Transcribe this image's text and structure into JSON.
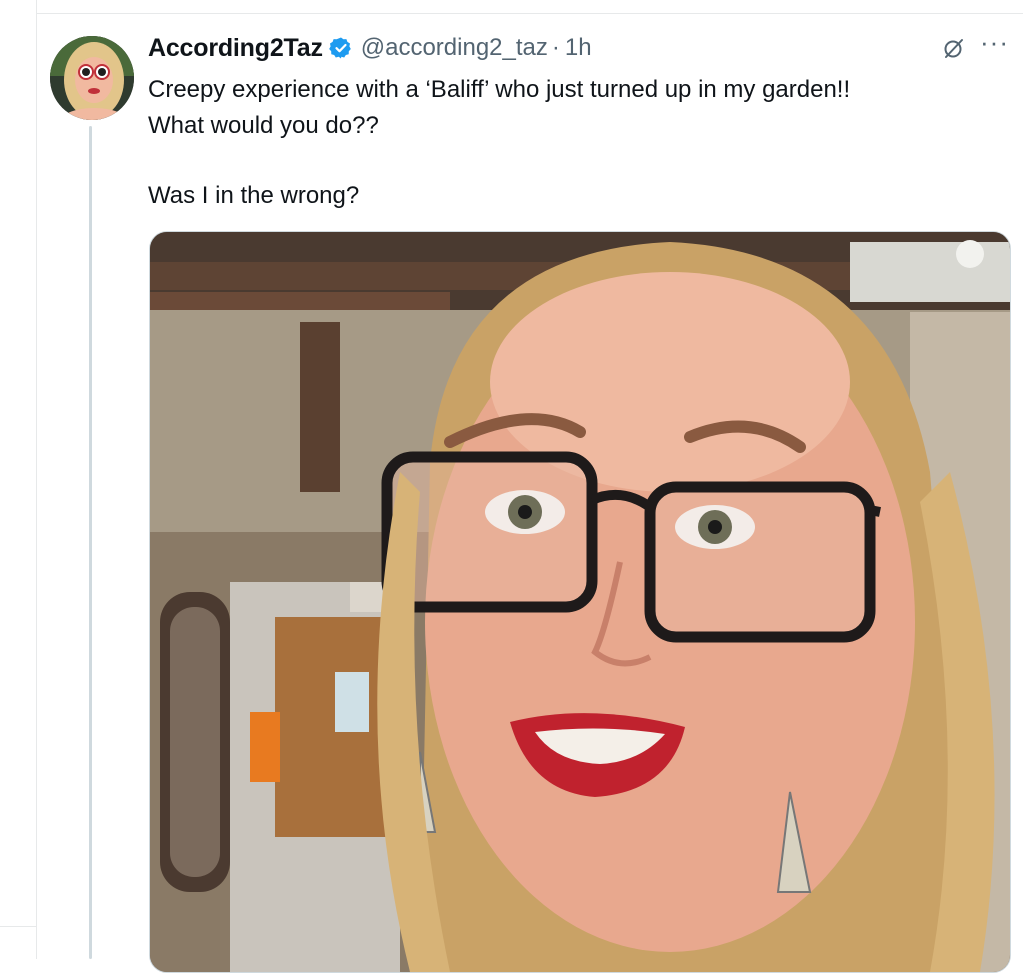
{
  "tweet": {
    "author": {
      "display_name": "According2Taz",
      "handle": "@according2_taz",
      "verified": true
    },
    "time": "1h",
    "separator": "·",
    "text_lines": [
      "Creepy experience with a ‘Baliff’ who just turned up in my garden!!",
      "What would you do??",
      "Was I in the wrong?"
    ],
    "media": {
      "type": "video-frame"
    }
  },
  "icons": {
    "grok": "grok-icon",
    "more": "more-options-icon",
    "verified": "verified-badge-icon"
  },
  "colors": {
    "verified_blue": "#1d9bf0",
    "text_primary": "#0f1419",
    "text_secondary": "#536471",
    "thread_line": "#cfd9de"
  }
}
